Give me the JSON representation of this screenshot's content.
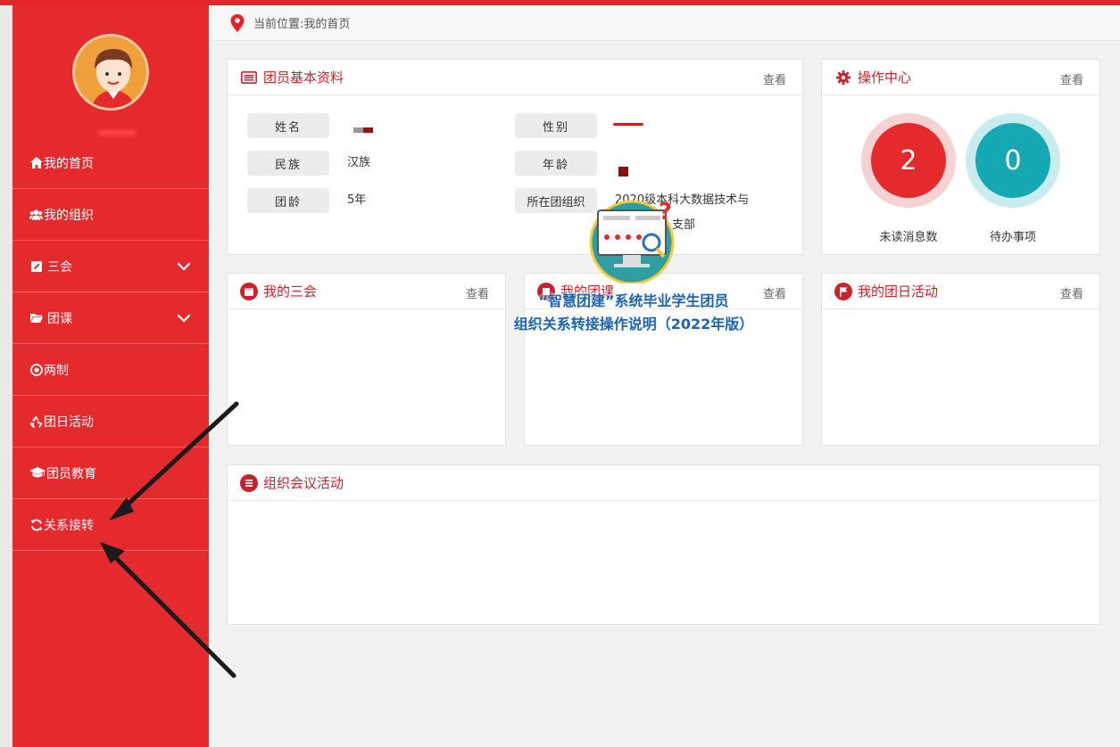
{
  "breadcrumb": {
    "text": "当前位置:我的首页"
  },
  "sidebar": {
    "items": [
      {
        "label": "我的首页",
        "icon": "home-icon"
      },
      {
        "label": "我的组织",
        "icon": "users-icon"
      },
      {
        "label": "三会",
        "icon": "edit-icon",
        "expandable": true
      },
      {
        "label": "团课",
        "icon": "folder-icon",
        "expandable": true
      },
      {
        "label": "两制",
        "icon": "target-icon"
      },
      {
        "label": "团日活动",
        "icon": "recycle-icon"
      },
      {
        "label": "团员教育",
        "icon": "graduation-cap-icon"
      },
      {
        "label": "关系接转",
        "icon": "refresh-icon"
      }
    ]
  },
  "profile_panel": {
    "title": "团员基本资料",
    "more": "查看",
    "fields": {
      "name_label": "姓名",
      "gender_label": "性别",
      "ethnicity_label": "民族",
      "ethnicity_value": "汉族",
      "age_label": "年龄",
      "league_age_label": "团龄",
      "league_age_value": "5年",
      "org_label": "所在团组织",
      "org_value_line1": "2020级本科大数据技术与",
      "org_value_line2": "支部"
    }
  },
  "ops_panel": {
    "title": "操作中心",
    "more": "查看",
    "unread_count": "2",
    "unread_label": "未读消息数",
    "todo_count": "0",
    "todo_label": "待办事项"
  },
  "sanhui_panel": {
    "title": "我的三会",
    "more": "查看"
  },
  "tuanke_panel": {
    "title": "我的团课",
    "more": "查看"
  },
  "tuanri_panel": {
    "title": "我的团日活动",
    "more": "查看"
  },
  "meeting_panel": {
    "title": "组织会议活动"
  },
  "overlay": {
    "line1": "“智慧团建”系统毕业学生团员",
    "line2": "组织关系转接操作说明（2022年版）"
  },
  "colors": {
    "primary_red": "#e52a2e",
    "title_red": "#c8232a",
    "teal": "#14a8b3"
  }
}
